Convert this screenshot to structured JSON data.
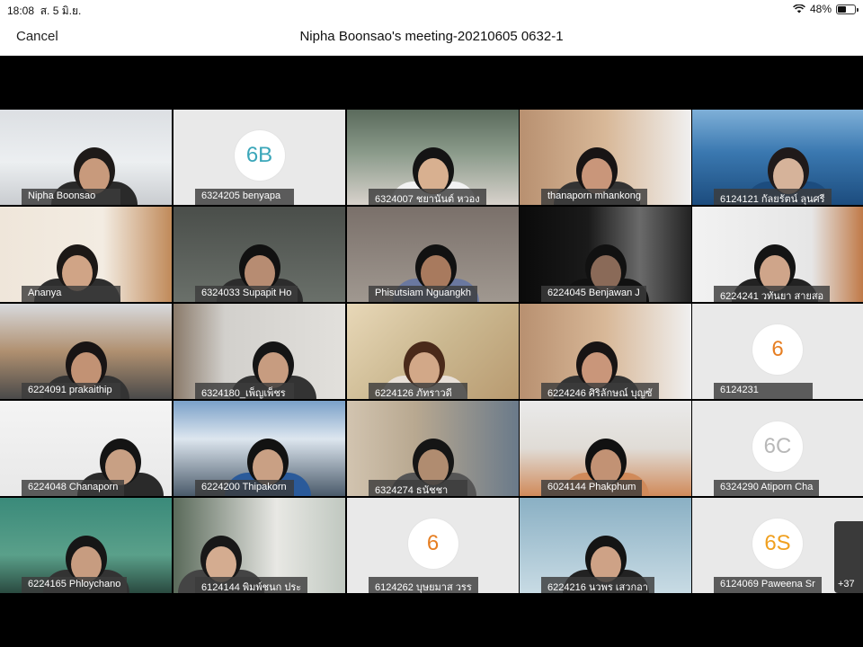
{
  "status": {
    "time": "18:08",
    "date": "ส. 5 มิ.ย.",
    "battery": "48%",
    "battery_level": 0.48
  },
  "nav": {
    "cancel_label": "Cancel",
    "title": "Nipha Boonsao's meeting-20210605 0632-1"
  },
  "participants": [
    {
      "name": "Nipha Boonsao",
      "type": "video"
    },
    {
      "name": "6324205 benyapa",
      "type": "avatar",
      "avatar_text": "6B",
      "avatar_color": "#3aa6b9"
    },
    {
      "name": "6324007 ชยานันต์ หวอง",
      "type": "video"
    },
    {
      "name": "thanaporn mhankong",
      "type": "video"
    },
    {
      "name": "6124121 กัลยรัตน์ ลุนศรี",
      "type": "video"
    },
    {
      "name": "Ananya",
      "type": "video"
    },
    {
      "name": "6324033 Supapit Ho",
      "type": "video"
    },
    {
      "name": "Phisutsiam Nguangkh",
      "type": "video"
    },
    {
      "name": "6224045 Benjawan J",
      "type": "video"
    },
    {
      "name": "6224241 วทันยา สายสอ",
      "type": "video"
    },
    {
      "name": "6224091 prakaithip",
      "type": "video"
    },
    {
      "name": "6324180_เพ็ญเพ็ชร",
      "type": "video"
    },
    {
      "name": "6224126 ภัทราวดี",
      "type": "video"
    },
    {
      "name": "6224246 ศิริลักษณ์ บุญซั",
      "type": "video"
    },
    {
      "name": "6124231",
      "type": "avatar",
      "avatar_text": "6",
      "avatar_color": "#e67e22"
    },
    {
      "name": "6224048 Chanaporn",
      "type": "video"
    },
    {
      "name": "6224200 Thipakorn",
      "type": "video"
    },
    {
      "name": "6324274 ธนัชชา",
      "type": "video"
    },
    {
      "name": "6024144 Phakphum",
      "type": "video"
    },
    {
      "name": "6324290 Atiporn Cha",
      "type": "avatar",
      "avatar_text": "6C",
      "avatar_color": "#b8b8b8"
    },
    {
      "name": "6224165 Phloychano",
      "type": "video"
    },
    {
      "name": "6124144 พิมพ์ชนก ประ",
      "type": "video"
    },
    {
      "name": "6124262 บุษยมาส วรร",
      "type": "avatar",
      "avatar_text": "6",
      "avatar_color": "#e67e22"
    },
    {
      "name": "6224216 นวพร เสวกอา",
      "type": "video"
    },
    {
      "name": "6124069 Paweena Sr",
      "type": "avatar",
      "avatar_text": "6S",
      "avatar_color": "#f0a020"
    }
  ],
  "more_participants": "+37"
}
